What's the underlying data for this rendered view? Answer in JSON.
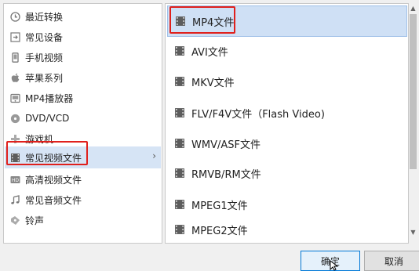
{
  "categories": [
    {
      "label": "最近转换",
      "icon": "history-icon"
    },
    {
      "label": "常见设备",
      "icon": "device-icon"
    },
    {
      "label": "手机视频",
      "icon": "phone-icon"
    },
    {
      "label": "苹果系列",
      "icon": "apple-icon"
    },
    {
      "label": "MP4播放器",
      "icon": "mp4-player-icon"
    },
    {
      "label": "DVD/VCD",
      "icon": "disc-icon"
    },
    {
      "label": "游戏机",
      "icon": "gamepad-icon"
    },
    {
      "label": "常见视频文件",
      "icon": "film-icon",
      "selected": true
    },
    {
      "label": "高清视频文件",
      "icon": "hd-icon"
    },
    {
      "label": "常见音频文件",
      "icon": "music-icon"
    },
    {
      "label": "铃声",
      "icon": "ringtone-icon"
    }
  ],
  "formats": [
    {
      "label": "MP4文件",
      "selected": true
    },
    {
      "label": "AVI文件"
    },
    {
      "label": "MKV文件"
    },
    {
      "label": "FLV/F4V文件（Flash Video)"
    },
    {
      "label": "WMV/ASF文件"
    },
    {
      "label": "RMVB/RM文件"
    },
    {
      "label": "MPEG1文件"
    },
    {
      "label": "MPEG2文件"
    }
  ],
  "buttons": {
    "ok_label": "确定",
    "cancel_label": "取消"
  },
  "colors": {
    "highlight_border": "#e0201c",
    "selection_bg": "#cfe0f5"
  }
}
